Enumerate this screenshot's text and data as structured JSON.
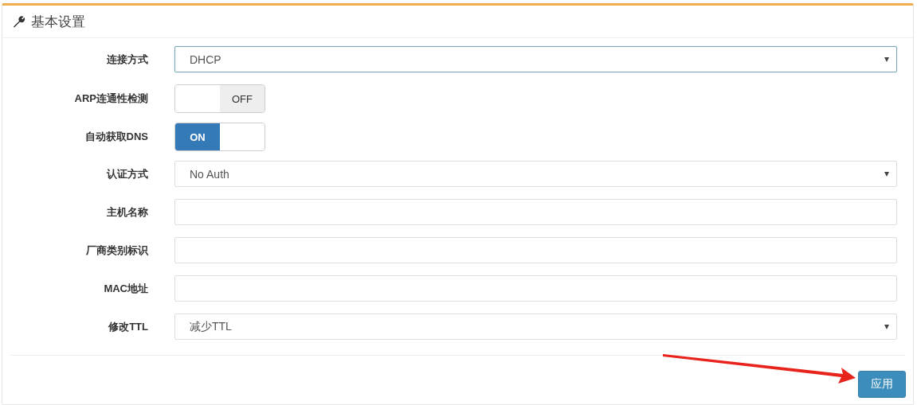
{
  "panel": {
    "title": "基本设置"
  },
  "rows": [
    {
      "kind": "select",
      "label": "连接方式",
      "value": "DHCP",
      "focused": true
    },
    {
      "kind": "toggle",
      "label": "ARP连通性检测",
      "on": false,
      "state_text": "OFF"
    },
    {
      "kind": "toggle",
      "label": "自动获取DNS",
      "on": true,
      "state_text": "ON"
    },
    {
      "kind": "select",
      "label": "认证方式",
      "value": "No Auth",
      "focused": false
    },
    {
      "kind": "text",
      "label": "主机名称"
    },
    {
      "kind": "text",
      "label": "厂商类别标识"
    },
    {
      "kind": "text",
      "label": "MAC地址"
    },
    {
      "kind": "select",
      "label": "修改TTL",
      "value": "减少TTL",
      "focused": false
    }
  ],
  "buttons": [
    "应用"
  ]
}
